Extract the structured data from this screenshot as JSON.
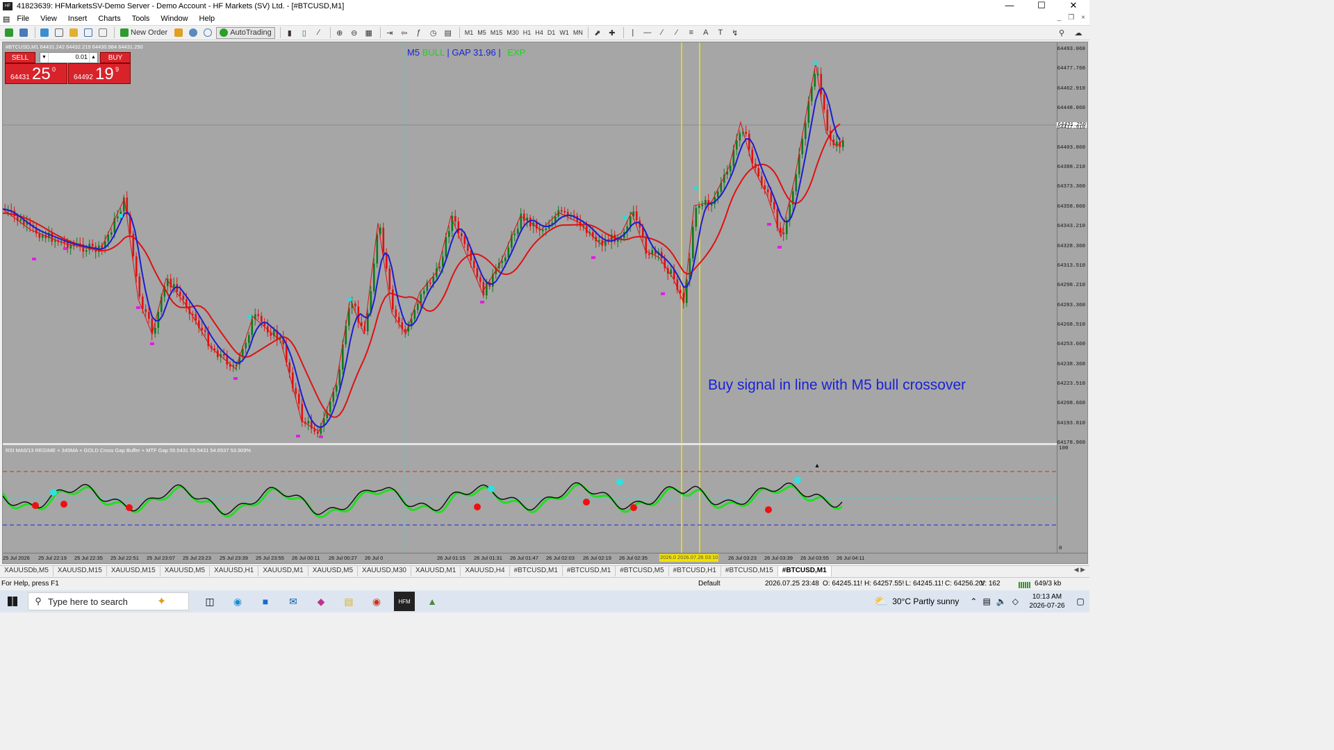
{
  "window": {
    "title": "41823639: HFMarketsSV-Demo Server - Demo Account - HF Markets (SV) Ltd. - [#BTCUSD,M1]"
  },
  "menu": [
    "File",
    "View",
    "Insert",
    "Charts",
    "Tools",
    "Window",
    "Help"
  ],
  "toolbar": {
    "new_order": "New Order",
    "autotrading": "AutoTrading",
    "timeframes": [
      "M1",
      "M5",
      "M15",
      "M30",
      "H1",
      "H4",
      "D1",
      "W1",
      "MN"
    ]
  },
  "chart": {
    "info": "#BTCUSD,M1  64431.242 64432.219 64430.984 64431.250",
    "trade": {
      "sell_label": "SELL",
      "buy_label": "BUY",
      "lot": "0.01",
      "sell_small": "64431",
      "sell_big": "25",
      "sell_sup": "0",
      "buy_small": "64492",
      "buy_big": "19",
      "buy_sup": "9"
    },
    "overlay": {
      "tf": "M5",
      "bull": "BULL",
      "gap": "| GAP 31.96 |",
      "exp": "EXP"
    },
    "annotation": "Buy signal  in line with M5 bull crossover",
    "indicator_label": "RSI MA5/13 REGIME + 345MA + GOLD Cross Gap Buffer + MTF Gap 55.5431 55.5431 54.6537 53.909%",
    "current_price": "64431.250",
    "price_ticks": [
      "64493.060",
      "64477.760",
      "64462.910",
      "64448.060",
      "64417.910",
      "64403.060",
      "64388.210",
      "64373.360",
      "64358.060",
      "64343.210",
      "64328.360",
      "64313.510",
      "64298.210",
      "64283.360",
      "64268.510",
      "64253.660",
      "64238.360",
      "64223.510",
      "64208.660",
      "64193.810",
      "64178.960"
    ],
    "ind_ticks": [
      "100",
      "0"
    ],
    "time_ticks": [
      "25 Jul 2026",
      "25 Jul 22:19",
      "25 Jul 22:35",
      "25 Jul 22:51",
      "25 Jul 23:07",
      "25 Jul 23:23",
      "25 Jul 23:39",
      "25 Jul 23:55",
      "26 Jul 00:11",
      "26 Jul 00:27",
      "26 Jul 0",
      "26 Jul 01:15",
      "26 Jul 01:31",
      "26 Jul 01:47",
      "26 Jul 02:03",
      "26 Jul 02:19",
      "26 Jul 02:35",
      "26 Jul 03:23",
      "26 Jul 03:39",
      "26 Jul 03:55",
      "26 Jul 04:11"
    ],
    "time_highlight": "2026.0 2026.07.26 03:10"
  },
  "tabs": [
    "XAUUSDb,M5",
    "XAUUSD,M15",
    "XAUUSD,M15",
    "XAUUSD,M5",
    "XAUUSD,H1",
    "XAUUSD,M1",
    "XAUUSD,M5",
    "XAUUSD,M30",
    "XAUUSD,M1",
    "XAUUSD,H4",
    "#BTCUSD,M1",
    "#BTCUSD,M1",
    "#BTCUSD,M5",
    "#BTCUSD,H1",
    "#BTCUSD,M15",
    "#BTCUSD,M1"
  ],
  "status": {
    "help": "For Help, press F1",
    "profile": "Default",
    "datetime": "2026.07.25 23:48",
    "open": "O: 64245.11!",
    "high": "H: 64257.55!",
    "low": "L: 64245.11!",
    "close": "C: 64256.20!",
    "volume": "V: 162",
    "traffic": "649/3 kb"
  },
  "taskbar": {
    "search_placeholder": "Type here to search",
    "weather": "30°C  Partly sunny",
    "time": "10:13 AM",
    "date": "2026-07-26"
  },
  "colors": {
    "chart_bg": "#a6a6a6",
    "sell_red": "#d9232b",
    "ma_fast": "#1c1ccf",
    "ma_slow": "#e01010",
    "signal_yellow": "#f5e600"
  }
}
